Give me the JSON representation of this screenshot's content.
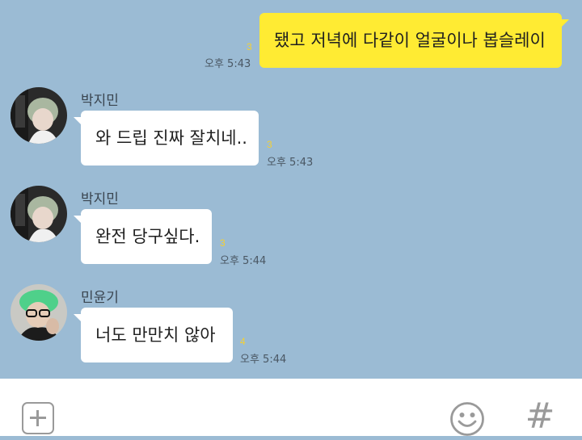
{
  "messages": [
    {
      "direction": "out",
      "text": "됐고 저녁에 다같이 얼굴이나 봅슬레이",
      "unread": "3",
      "time": "오후 5:43"
    },
    {
      "direction": "in",
      "sender": "박지민",
      "text": "와 드립 진짜 잘치네..",
      "unread": "3",
      "time": "오후 5:43"
    },
    {
      "direction": "in",
      "sender": "박지민",
      "text": "완전 당구싶다.",
      "unread": "3",
      "time": "오후 5:44"
    },
    {
      "direction": "in",
      "sender": "민윤기",
      "text": "너도 만만치 않아",
      "unread": "4",
      "time": "오후 5:44"
    }
  ],
  "input_bar": {
    "plus_icon": "plus-icon",
    "emoji_icon": "emoticon-icon",
    "hash_icon": "hash-icon",
    "hash_label": "#"
  },
  "colors": {
    "background": "#9bbbd4",
    "outgoing_bubble": "#ffeb33",
    "incoming_bubble": "#ffffff",
    "unread_count": "#f5d033"
  }
}
